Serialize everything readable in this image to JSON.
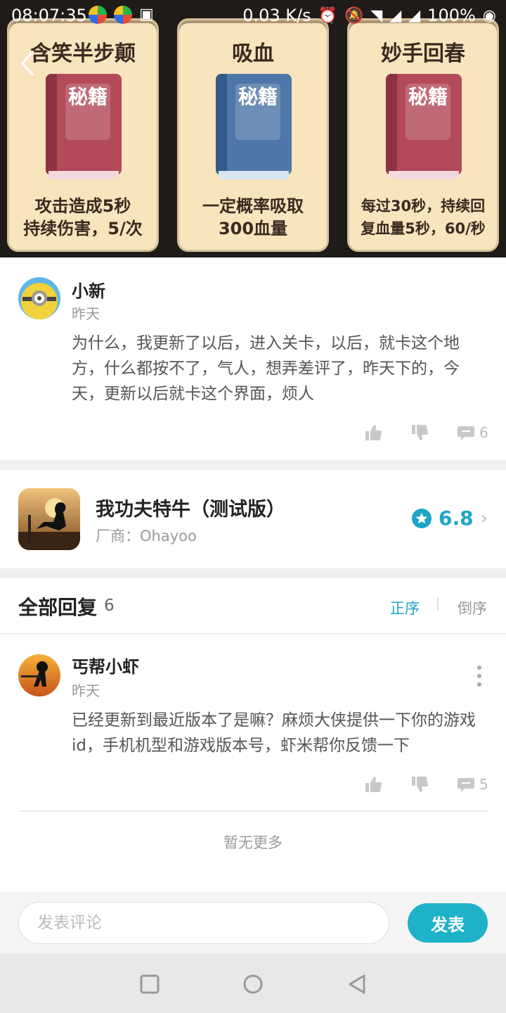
{
  "status_bar": {
    "time": "08:07:35",
    "net_speed": "0.03 K/s",
    "battery": "100%"
  },
  "banner": {
    "cards": [
      {
        "title": "含笑半步颠",
        "book_text": "秘籍",
        "desc_line1": "攻击造成5秒",
        "desc_line2": "持续伤害，5/次",
        "book_color": "#b34a5a"
      },
      {
        "title": "吸血",
        "book_text": "秘籍",
        "desc_line1": "一定概率吸取",
        "desc_line2": "300血量",
        "book_color": "#4f76a8"
      },
      {
        "title": "妙手回春",
        "book_text": "秘籍",
        "desc_line1": "每过30秒，持续回",
        "desc_line2": "复血量5秒，60/秒",
        "book_color": "#b34a5a"
      }
    ]
  },
  "main_comment": {
    "user": "小新",
    "time": "昨天",
    "text": "为什么，我更新了以后，进入关卡，以后，就卡这个地方，什么都按不了，气人，想弄差评了，昨天下的，今天，更新以后就卡这个界面，烦人",
    "reply_count": "6"
  },
  "game": {
    "title": "我功夫特牛（测试版）",
    "maker": "厂商：Ohayoo",
    "score": "6.8"
  },
  "replies": {
    "header": "全部回复",
    "count": "6",
    "sort_asc": "正序",
    "sort_desc": "倒序",
    "items": [
      {
        "user": "丐帮小虾",
        "time": "昨天",
        "text": "已经更新到最近版本了是嘛？麻烦大侠提供一下你的游戏id，手机机型和游戏版本号，虾米帮你反馈一下",
        "reply_count": "5"
      }
    ],
    "no_more": "暂无更多"
  },
  "composer": {
    "placeholder": "发表评论",
    "button": "发表"
  },
  "colors": {
    "accent": "#1db2c8",
    "banner_bg": "#1e1b19",
    "card_bg": "#f8e4bd"
  }
}
